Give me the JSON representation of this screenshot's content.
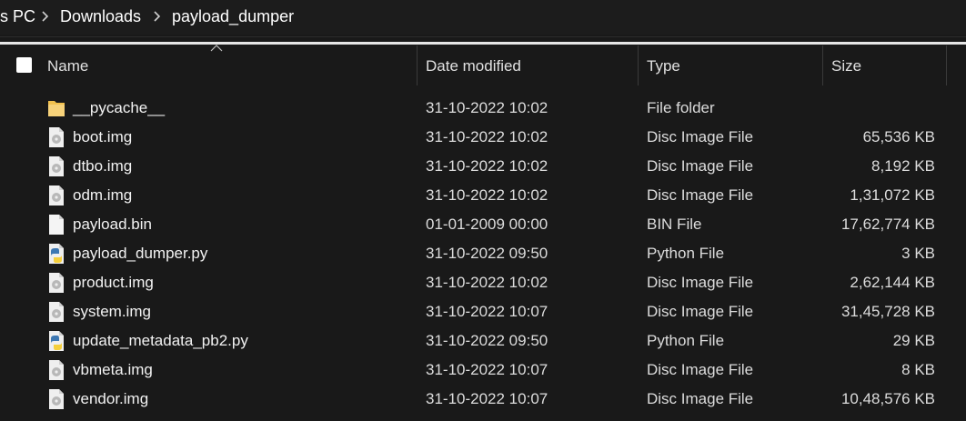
{
  "breadcrumb": {
    "items": [
      "s PC",
      "Downloads",
      "payload_dumper"
    ]
  },
  "columns": {
    "name": "Name",
    "date_modified": "Date modified",
    "type": "Type",
    "size": "Size"
  },
  "files": [
    {
      "name": "__pycache__",
      "date": "31-10-2022 10:02",
      "type": "File folder",
      "size": "",
      "icon": "folder-icon"
    },
    {
      "name": "boot.img",
      "date": "31-10-2022 10:02",
      "type": "Disc Image File",
      "size": "65,536 KB",
      "icon": "disc-image-file-icon"
    },
    {
      "name": "dtbo.img",
      "date": "31-10-2022 10:02",
      "type": "Disc Image File",
      "size": "8,192 KB",
      "icon": "disc-image-file-icon"
    },
    {
      "name": "odm.img",
      "date": "31-10-2022 10:02",
      "type": "Disc Image File",
      "size": "1,31,072 KB",
      "icon": "disc-image-file-icon"
    },
    {
      "name": "payload.bin",
      "date": "01-01-2009 00:00",
      "type": "BIN File",
      "size": "17,62,774 KB",
      "icon": "generic-file-icon"
    },
    {
      "name": "payload_dumper.py",
      "date": "31-10-2022 09:50",
      "type": "Python File",
      "size": "3 KB",
      "icon": "python-file-icon"
    },
    {
      "name": "product.img",
      "date": "31-10-2022 10:02",
      "type": "Disc Image File",
      "size": "2,62,144 KB",
      "icon": "disc-image-file-icon"
    },
    {
      "name": "system.img",
      "date": "31-10-2022 10:07",
      "type": "Disc Image File",
      "size": "31,45,728 KB",
      "icon": "disc-image-file-icon"
    },
    {
      "name": "update_metadata_pb2.py",
      "date": "31-10-2022 09:50",
      "type": "Python File",
      "size": "29 KB",
      "icon": "python-file-icon"
    },
    {
      "name": "vbmeta.img",
      "date": "31-10-2022 10:07",
      "type": "Disc Image File",
      "size": "8 KB",
      "icon": "disc-image-file-icon"
    },
    {
      "name": "vendor.img",
      "date": "31-10-2022 10:07",
      "type": "Disc Image File",
      "size": "10,48,576 KB",
      "icon": "disc-image-file-icon"
    }
  ],
  "colors": {
    "background": "#191919",
    "text": "#ffffff",
    "folder": "#f2c14e",
    "python_blue": "#3d78b3",
    "python_yellow": "#f5cf3b"
  }
}
